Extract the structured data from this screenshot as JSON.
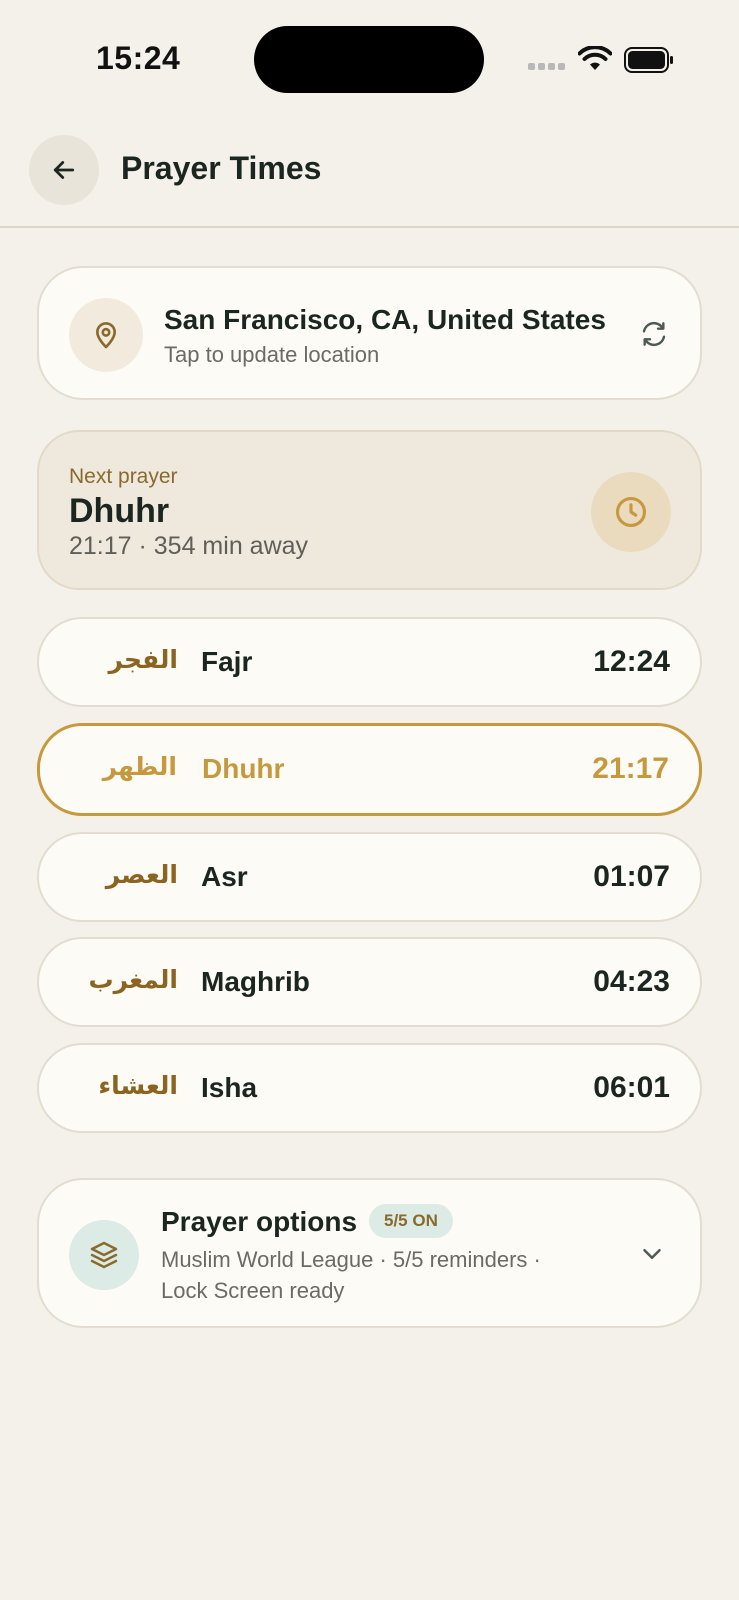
{
  "status_bar": {
    "time": "15:24"
  },
  "header": {
    "title": "Prayer Times"
  },
  "location": {
    "title": "San Francisco, CA, United States",
    "subtitle": "Tap to update location"
  },
  "next_prayer": {
    "label": "Next prayer",
    "name": "Dhuhr",
    "detail": "21:17 · 354 min away"
  },
  "prayers": [
    {
      "arabic": "الفجر",
      "name": "Fajr",
      "time": "12:24",
      "active": false
    },
    {
      "arabic": "الظهر",
      "name": "Dhuhr",
      "time": "21:17",
      "active": true
    },
    {
      "arabic": "العصر",
      "name": "Asr",
      "time": "01:07",
      "active": false
    },
    {
      "arabic": "المغرب",
      "name": "Maghrib",
      "time": "04:23",
      "active": false
    },
    {
      "arabic": "العشاء",
      "name": "Isha",
      "time": "06:01",
      "active": false
    }
  ],
  "options": {
    "title": "Prayer options",
    "badge": "5/5 ON",
    "subtitle": "Muslim World League · 5/5 reminders · Lock Screen ready"
  },
  "colors": {
    "background": "#f4f1ea",
    "accent_gold": "#c6993f",
    "arabic_brown": "#8a6420",
    "card": "#fdfbf5",
    "mint": "#dcebe6"
  },
  "icons": {
    "back": "arrow-left-icon",
    "location": "map-pin-icon",
    "refresh": "refresh-icon",
    "next": "clock-icon",
    "options": "layers-icon",
    "expand": "chevron-down-icon"
  }
}
